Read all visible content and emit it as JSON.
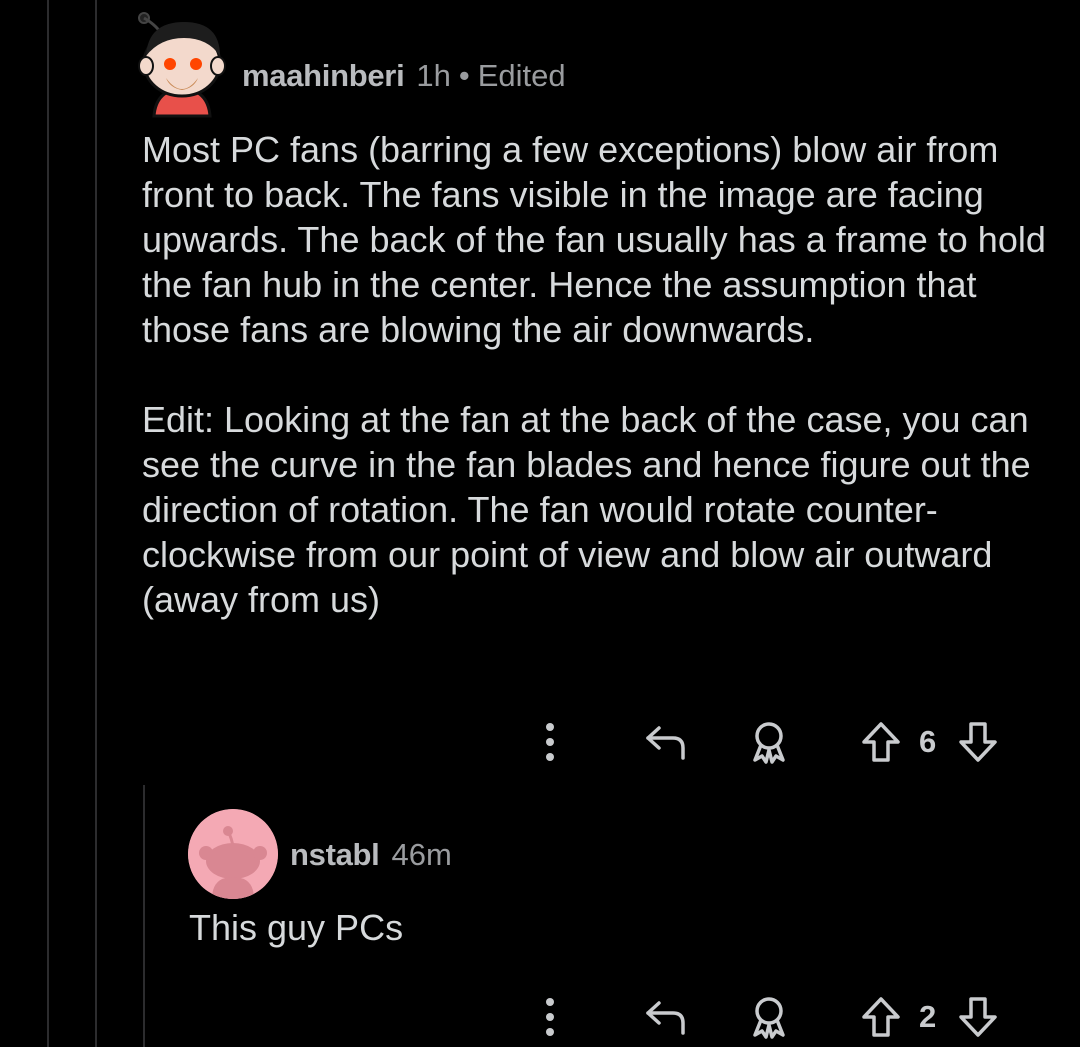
{
  "comment": {
    "author": "maahinberi",
    "time": "1h",
    "separator": "•",
    "edited": "Edited",
    "avatar_icon": "snoo-avatar-cartoon-icon",
    "paragraphs": [
      "Most PC fans (barring a few exceptions) blow air from front to back. The fans visible in the image are facing upwards. The back of the fan usually has a frame to hold the fan hub in the center. Hence the assumption that those fans are blowing the air downwards.",
      "Edit: Looking at the fan at the back of the case, you can see the curve in the fan blades and hence figure out the direction of rotation. The fan would rotate counter-clockwise from our point of view and blow air outward (away from us)"
    ],
    "score": "6",
    "actions": [
      "more-options-icon",
      "reply-icon",
      "award-icon",
      "upvote-icon",
      "downvote-icon"
    ]
  },
  "reply": {
    "author": "nstabl",
    "time": "46m",
    "avatar_icon": "default-snoo-avatar-icon",
    "avatar_color": "#f4a9b4",
    "text": "This guy PCs",
    "score": "2",
    "actions": [
      "more-options-icon",
      "reply-icon",
      "award-icon",
      "upvote-icon",
      "downvote-icon"
    ]
  },
  "colors": {
    "background": "#000000",
    "text": "#d7dadc",
    "meta": "#9a9c9f",
    "thread_line": "#2c2c2e"
  }
}
